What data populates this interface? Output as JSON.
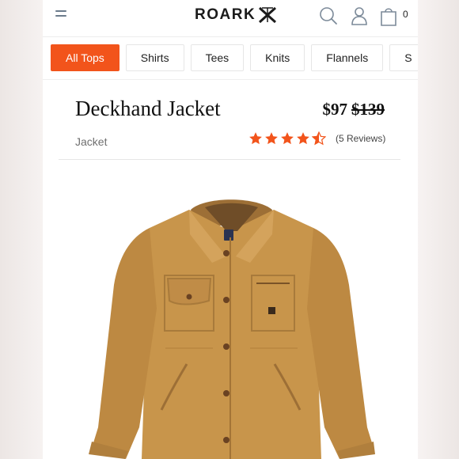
{
  "header": {
    "logo_text": "ROARK",
    "cart_count": "0"
  },
  "tabs": [
    {
      "label": "All Tops",
      "active": true
    },
    {
      "label": "Shirts"
    },
    {
      "label": "Tees"
    },
    {
      "label": "Knits"
    },
    {
      "label": "Flannels"
    },
    {
      "label": "S"
    }
  ],
  "product": {
    "title": "Deckhand Jacket",
    "price": "$97",
    "was_price": "$139",
    "type": "Jacket",
    "rating": 4.5,
    "reviews": "(5 Reviews)"
  },
  "colors": {
    "accent": "#f2541b",
    "jacket": "#c8954b"
  }
}
